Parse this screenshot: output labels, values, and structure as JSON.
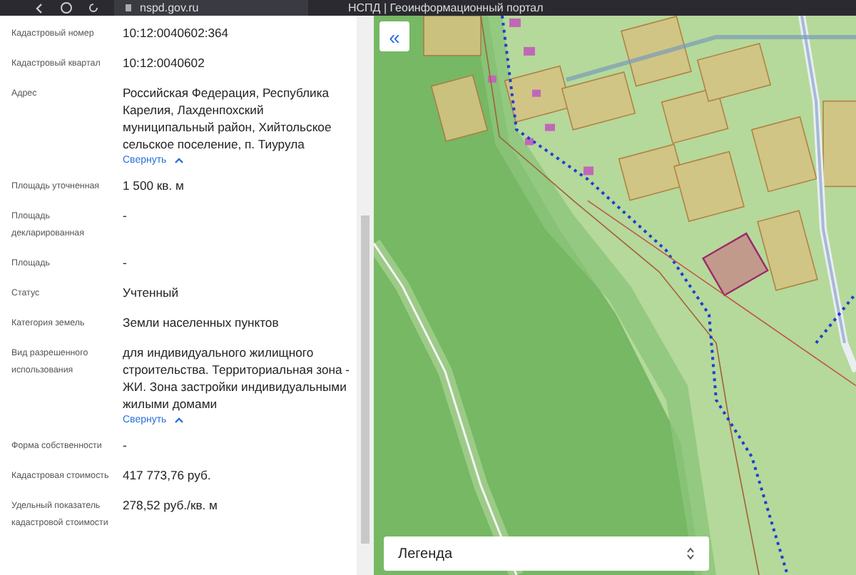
{
  "browser": {
    "url": "nspd.gov.ru",
    "page_title": "НСПД | Геоинформационный портал"
  },
  "fields": [
    {
      "label": "Кадастровый номер",
      "value": "10:12:0040602:364"
    },
    {
      "label": "Кадастровый квартал",
      "value": "10:12:0040602"
    },
    {
      "label": "Адрес",
      "value": "Российская Федерация, Республика Карелия, Лахденпохский муниципальный район, Хийтольское сельское поселение, п. Тиурула",
      "collapse_link": "Свернуть"
    },
    {
      "label": "Площадь уточненная",
      "value": "1 500 кв. м"
    },
    {
      "label": "Площадь декларированная",
      "value": "-"
    },
    {
      "label": "Площадь",
      "value": "-"
    },
    {
      "label": "Статус",
      "value": "Учтенный"
    },
    {
      "label": "Категория земель",
      "value": "Земли населенных пунктов"
    },
    {
      "label": "Вид разрешенного использования",
      "value": "для индивидуального жилищного строительства. Территориальная зона - ЖИ. Зона застройки индивидуальными жилыми домами",
      "collapse_link": "Свернуть"
    },
    {
      "label": "Форма собственности",
      "value": "-"
    },
    {
      "label": "Кадастровая стоимость",
      "value": "417 773,76 руб."
    },
    {
      "label": "Удельный показатель кадастровой стоимости",
      "value": "278,52 руб./кв. м"
    }
  ],
  "map": {
    "collapse_button": "«",
    "legend": {
      "label": "Легенда"
    }
  }
}
